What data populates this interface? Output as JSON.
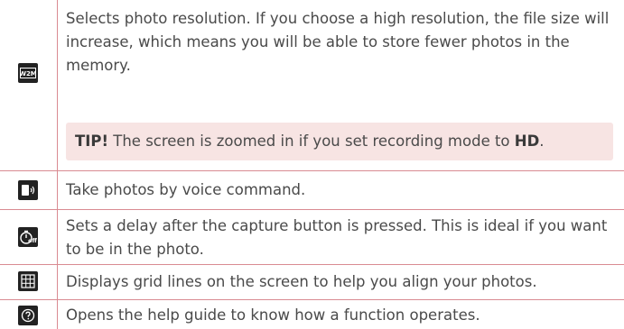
{
  "rows": [
    {
      "icon": "photo-size-w2m-icon",
      "icon_text": "W2M",
      "text": "Selects photo resolution. If you choose a high resolution, the file size will increase, which means you will be able to store fewer photos in the memory."
    },
    {
      "icon": "voice-shutter-icon",
      "text": "Take photos by voice command."
    },
    {
      "icon": "timer-off-icon",
      "icon_text": "off",
      "text": "Sets a delay after the capture button is pressed. This is ideal if you want to be in the photo."
    },
    {
      "icon": "grid-icon",
      "text": "Displays grid lines on the screen to help you align your photos."
    },
    {
      "icon": "help-icon",
      "text": "Opens the help guide to know how a function operates."
    }
  ],
  "tip": {
    "label": "TIP!",
    "text_before": " The screen is zoomed in if you set recording mode to ",
    "bold": "HD",
    "text_after": "."
  }
}
